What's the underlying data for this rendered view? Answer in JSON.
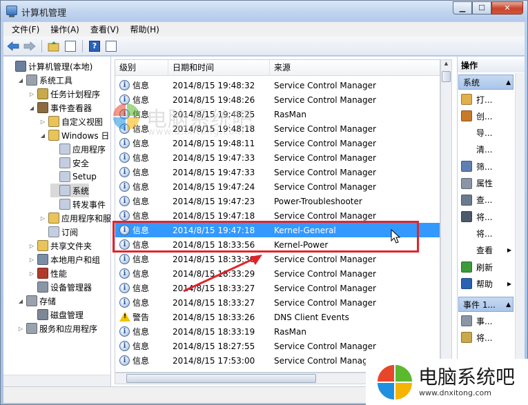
{
  "window": {
    "title": "计算机管理"
  },
  "menu": [
    "文件(F)",
    "操作(A)",
    "查看(V)",
    "帮助(H)"
  ],
  "tree": [
    {
      "label": "计算机管理(本地)",
      "indent": 0,
      "twisty": "",
      "icon": "computer-management-icon",
      "color": "#6a7f9c"
    },
    {
      "label": "系统工具",
      "indent": 1,
      "twisty": "◢",
      "icon": "system-tools-icon",
      "color": "#9aa2ad"
    },
    {
      "label": "任务计划程序",
      "indent": 2,
      "twisty": "▷",
      "icon": "task-scheduler-icon",
      "color": "#c9a94a"
    },
    {
      "label": "事件查看器",
      "indent": 2,
      "twisty": "◢",
      "icon": "event-viewer-icon",
      "color": "#8c6b3f"
    },
    {
      "label": "自定义视图",
      "indent": 3,
      "twisty": "▷",
      "icon": "folder-icon",
      "color": "#e8c45a"
    },
    {
      "label": "Windows 日",
      "indent": 3,
      "twisty": "◢",
      "icon": "folder-icon",
      "color": "#e8c45a"
    },
    {
      "label": "应用程序",
      "indent": 4,
      "twisty": "",
      "icon": "log-icon",
      "color": "#c3cfe0"
    },
    {
      "label": "安全",
      "indent": 4,
      "twisty": "",
      "icon": "log-icon",
      "color": "#c3cfe0"
    },
    {
      "label": "Setup",
      "indent": 4,
      "twisty": "",
      "icon": "log-icon",
      "color": "#c3cfe0"
    },
    {
      "label": "系统",
      "indent": 4,
      "twisty": "",
      "icon": "log-icon",
      "color": "#c3cfe0",
      "selected": true
    },
    {
      "label": "转发事件",
      "indent": 4,
      "twisty": "",
      "icon": "log-icon",
      "color": "#c3cfe0"
    },
    {
      "label": "应用程序和服",
      "indent": 3,
      "twisty": "▷",
      "icon": "folder-icon",
      "color": "#e8c45a"
    },
    {
      "label": "订阅",
      "indent": 3,
      "twisty": "",
      "icon": "subscription-icon",
      "color": "#c3cfe0"
    },
    {
      "label": "共享文件夹",
      "indent": 2,
      "twisty": "▷",
      "icon": "shared-folder-icon",
      "color": "#e8c45a"
    },
    {
      "label": "本地用户和组",
      "indent": 2,
      "twisty": "▷",
      "icon": "users-icon",
      "color": "#7a8ca6"
    },
    {
      "label": "性能",
      "indent": 2,
      "twisty": "▷",
      "icon": "performance-icon",
      "color": "#b23a2a"
    },
    {
      "label": "设备管理器",
      "indent": 2,
      "twisty": "",
      "icon": "device-manager-icon",
      "color": "#8a95a5"
    },
    {
      "label": "存储",
      "indent": 1,
      "twisty": "◢",
      "icon": "storage-icon",
      "color": "#9aa2ad"
    },
    {
      "label": "磁盘管理",
      "indent": 2,
      "twisty": "",
      "icon": "disk-icon",
      "color": "#7d8796"
    },
    {
      "label": "服务和应用程序",
      "indent": 1,
      "twisty": "▷",
      "icon": "services-icon",
      "color": "#9aa2ad"
    }
  ],
  "grid": {
    "headers": [
      "级别",
      "日期和时间",
      "来源"
    ],
    "rows": [
      {
        "level": "信息",
        "type": "info",
        "date": "2014/8/15 19:48:32",
        "source": "Service Control Manager"
      },
      {
        "level": "信息",
        "type": "info",
        "date": "2014/8/15 19:48:26",
        "source": "Service Control Manager"
      },
      {
        "level": "信息",
        "type": "info",
        "date": "2014/8/15 19:48:25",
        "source": "RasMan"
      },
      {
        "level": "信息",
        "type": "info",
        "date": "2014/8/15 19:48:18",
        "source": "Service Control Manager"
      },
      {
        "level": "信息",
        "type": "info",
        "date": "2014/8/15 19:48:11",
        "source": "Service Control Manager"
      },
      {
        "level": "信息",
        "type": "info",
        "date": "2014/8/15 19:47:33",
        "source": "Service Control Manager"
      },
      {
        "level": "信息",
        "type": "info",
        "date": "2014/8/15 19:47:33",
        "source": "Service Control Manager"
      },
      {
        "level": "信息",
        "type": "info",
        "date": "2014/8/15 19:47:24",
        "source": "Service Control Manager"
      },
      {
        "level": "信息",
        "type": "info",
        "date": "2014/8/15 19:47:23",
        "source": "Power-Troubleshooter"
      },
      {
        "level": "信息",
        "type": "info",
        "date": "2014/8/15 19:47:18",
        "source": "Service Control Manager"
      },
      {
        "level": "信息",
        "type": "info",
        "date": "2014/8/15 19:47:18",
        "source": "Kernel-General",
        "selected": true
      },
      {
        "level": "信息",
        "type": "info",
        "date": "2014/8/15 18:33:56",
        "source": "Kernel-Power"
      },
      {
        "level": "信息",
        "type": "info",
        "date": "2014/8/15 18:33:30",
        "source": "Service Control Manager"
      },
      {
        "level": "信息",
        "type": "info",
        "date": "2014/8/15 18:33:29",
        "source": "Service Control Manager"
      },
      {
        "level": "信息",
        "type": "info",
        "date": "2014/8/15 18:33:27",
        "source": "Service Control Manager"
      },
      {
        "level": "信息",
        "type": "info",
        "date": "2014/8/15 18:33:27",
        "source": "Service Control Manager"
      },
      {
        "level": "警告",
        "type": "warning",
        "date": "2014/8/15 18:33:26",
        "source": "DNS Client Events"
      },
      {
        "level": "信息",
        "type": "info",
        "date": "2014/8/15 18:33:19",
        "source": "RasMan"
      },
      {
        "level": "信息",
        "type": "info",
        "date": "2014/8/15 18:27:55",
        "source": "Service Control Manager"
      },
      {
        "level": "信息",
        "type": "info",
        "date": "2014/8/15 17:53:00",
        "source": "Service Control Manager"
      }
    ]
  },
  "actions": {
    "title": "操作",
    "section1": "系统",
    "items": [
      {
        "label": "打...",
        "icon": "open-log-icon",
        "color": "#e0b14a"
      },
      {
        "label": "创...",
        "icon": "create-view-icon",
        "color": "#c87a2a"
      },
      {
        "label": "导...",
        "icon": "",
        "color": ""
      },
      {
        "label": "清...",
        "icon": "",
        "color": ""
      },
      {
        "label": "筛...",
        "icon": "filter-icon",
        "color": "#5f7fb0"
      },
      {
        "label": "属性",
        "icon": "properties-icon",
        "color": "#8a95a5"
      },
      {
        "label": "查...",
        "icon": "find-icon",
        "color": "#6b7a8f"
      },
      {
        "label": "将...",
        "icon": "save-icon",
        "color": "#4d5a6c"
      },
      {
        "label": "将...",
        "icon": "",
        "color": ""
      },
      {
        "label": "查看",
        "icon": "",
        "color": "",
        "submenu": true
      },
      {
        "label": "刷新",
        "icon": "refresh-icon",
        "color": "#3c9a3c"
      },
      {
        "label": "帮助",
        "icon": "help-icon",
        "color": "#2a62b5",
        "submenu": true
      }
    ],
    "section2": "事件 1...",
    "items2": [
      {
        "label": "事...",
        "icon": "event-properties-icon",
        "color": "#8a95a5"
      },
      {
        "label": "将...",
        "icon": "attach-task-icon",
        "color": "#c9a94a"
      }
    ]
  },
  "watermark": {
    "brand": "电脑系统吧",
    "url": "www.dnxitong.com"
  },
  "colors": {
    "selection": "#3399ff",
    "highlight": "#e0242a"
  }
}
